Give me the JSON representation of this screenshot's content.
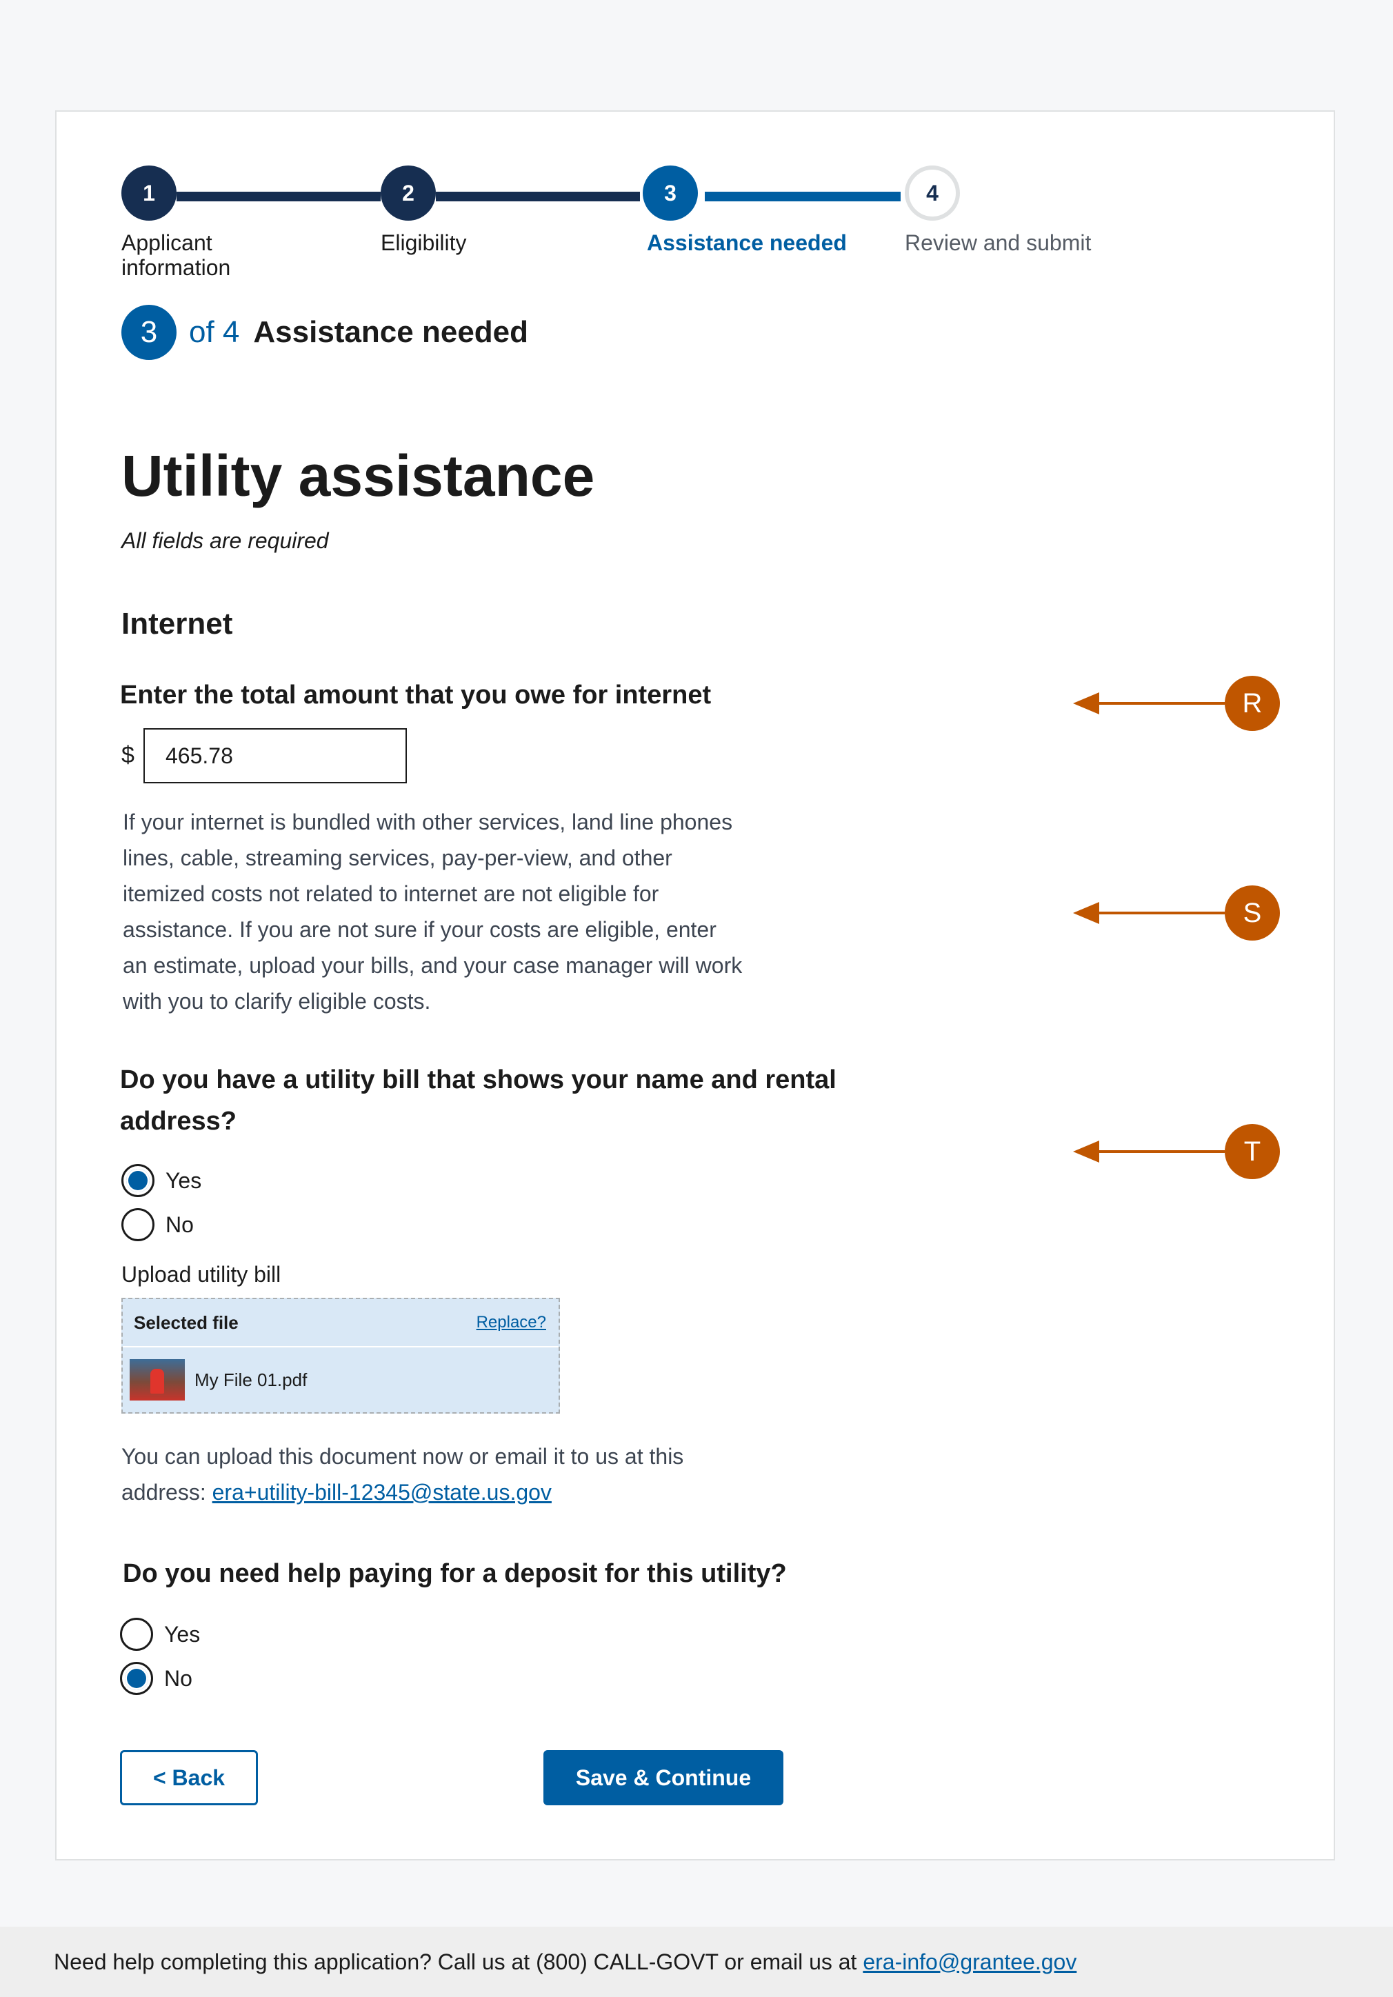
{
  "steps": [
    {
      "number": "1",
      "label": "Applicant information",
      "status": "complete"
    },
    {
      "number": "2",
      "label": "Eligibility",
      "status": "complete"
    },
    {
      "number": "3",
      "label": "Assistance needed",
      "status": "current"
    },
    {
      "number": "4",
      "label": "Review and submit",
      "status": "incomplete"
    }
  ],
  "step_counter": {
    "current": "3",
    "of_text": "of 4",
    "title": "Assistance needed"
  },
  "page": {
    "title": "Utility assistance",
    "required_note": "All fields are required"
  },
  "section": {
    "title": "Internet"
  },
  "amount": {
    "question": "Enter the total amount that you owe for internet",
    "currency": "$",
    "value": "465.78",
    "hint": "If your internet is bundled with other services, land line phones lines, cable, streaming services, pay-per-view, and other itemized costs not related to internet are not eligible for assistance. If you are not sure if your costs are eligible, enter an estimate, upload your bills, and your case manager will work with you to clarify eligible costs."
  },
  "bill_question": {
    "question": "Do you have a utility bill that shows your name and rental address?",
    "options": [
      {
        "label": "Yes",
        "checked": true
      },
      {
        "label": "No",
        "checked": false
      }
    ]
  },
  "upload": {
    "label": "Upload utility bill",
    "selected_heading": "Selected file",
    "replace_label": "Replace?",
    "file_name": "My File 01.pdf",
    "note_prefix": "You can upload this document now or email it to us at this address: ",
    "email": "era+utility-bill-12345@state.us.gov"
  },
  "deposit_question": {
    "question": "Do you need help paying for a deposit for this utility?",
    "options": [
      {
        "label": "Yes",
        "checked": false
      },
      {
        "label": "No",
        "checked": true
      }
    ]
  },
  "buttons": {
    "back": "< Back",
    "save": "Save & Continue"
  },
  "annotations": [
    "R",
    "S",
    "T"
  ],
  "footer": {
    "text": "Need help completing this application? Call us at (800) CALL-GOVT or email us at ",
    "email": "era-info@grantee.gov"
  },
  "colors": {
    "primary": "#005ea2",
    "primary_darker": "#162e51",
    "annotation": "#c05600",
    "file_bg": "#d9e8f6"
  }
}
